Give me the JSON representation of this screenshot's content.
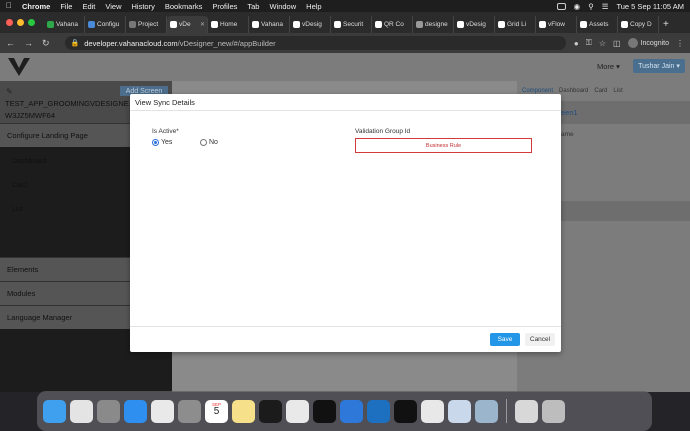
{
  "menubar": {
    "app": "Chrome",
    "items": [
      "File",
      "Edit",
      "View",
      "History",
      "Bookmarks",
      "Profiles",
      "Tab",
      "Window",
      "Help"
    ],
    "clock": "Tue 5 Sep  11:05 AM"
  },
  "tabs": [
    {
      "label": "Vahana",
      "color": "#2ea84a"
    },
    {
      "label": "Configu",
      "color": "#4a8ad8"
    },
    {
      "label": "Project",
      "color": "#777777"
    },
    {
      "label": "vDe",
      "color": "#ffffff",
      "active": true
    },
    {
      "label": "Home",
      "color": "#ffffff"
    },
    {
      "label": "Vahana",
      "color": "#ffffff"
    },
    {
      "label": "vDesig",
      "color": "#ffffff"
    },
    {
      "label": "Securit",
      "color": "#ffffff"
    },
    {
      "label": "QR Co",
      "color": "#ffffff"
    },
    {
      "label": "designe",
      "color": "#999999"
    },
    {
      "label": "vDesig",
      "color": "#ffffff"
    },
    {
      "label": "Grid Li",
      "color": "#ffffff"
    },
    {
      "label": "vFlow",
      "color": "#ffffff"
    },
    {
      "label": "Assets",
      "color": "#ffffff"
    },
    {
      "label": "Copy D",
      "color": "#ffffff"
    }
  ],
  "address": {
    "host": "developer.vahanacloud.com",
    "path": "/vDesigner_new/#/appBuilder",
    "profile": "Incognito"
  },
  "app": {
    "more_label": "More",
    "user_label": "Tushar Jain",
    "add_screen_label": "Add Screen",
    "app_name": "TEST_APP_GROOMINGVDESIGNE...",
    "app_id": "W3JZ5MWF64",
    "configure_landing": "Configure Landing Page",
    "landing_items": [
      "Dashboard",
      "Card",
      "List"
    ],
    "sections": [
      "Elements",
      "Modules",
      "Language Manager"
    ],
    "right_tabs": [
      "Component",
      "Dashboard",
      "Card",
      "List"
    ],
    "right_peek_title": "een1",
    "right_peek_sub": "ame"
  },
  "modal": {
    "title": "View Sync Details",
    "is_active_label": "Is Active*",
    "yes_label": "Yes",
    "no_label": "No",
    "selected": "Yes",
    "validation_label": "Validation Group Id",
    "validation_value": "Business Rule",
    "save_label": "Save",
    "cancel_label": "Cancel"
  },
  "dock": {
    "calendar_month": "SEP",
    "calendar_day": "5",
    "apps": [
      {
        "name": "finder-icon",
        "color": "#3fa0ef"
      },
      {
        "name": "launchpad-icon",
        "color": "#e4e4e4"
      },
      {
        "name": "photo-preview-icon",
        "color": "#8a8a8a"
      },
      {
        "name": "safari-icon",
        "color": "#2f8ff0"
      },
      {
        "name": "chrome-icon",
        "color": "#e9e9e9"
      },
      {
        "name": "system-preferences-icon",
        "color": "#8d8d8d"
      },
      {
        "name": "calendar-icon",
        "color": "#ffffff"
      },
      {
        "name": "notes-icon",
        "color": "#f6e08a"
      },
      {
        "name": "activity-monitor-icon",
        "color": "#1b1b1b"
      },
      {
        "name": "postman-icon",
        "color": "#e9e9e9"
      },
      {
        "name": "terminal-icon",
        "color": "#111111"
      },
      {
        "name": "xcode-icon",
        "color": "#2d78d8"
      },
      {
        "name": "vscode-icon",
        "color": "#1d6fc0"
      },
      {
        "name": "intellij-icon",
        "color": "#111111"
      },
      {
        "name": "textedit-icon",
        "color": "#e8e8e8"
      },
      {
        "name": "preview-icon",
        "color": "#c9d8ea"
      },
      {
        "name": "quicktime-icon",
        "color": "#9ab5cc"
      },
      {
        "name": "documents-icon",
        "color": "#d8d8d8"
      },
      {
        "name": "trash-icon",
        "color": "#bdbdbd"
      }
    ]
  }
}
